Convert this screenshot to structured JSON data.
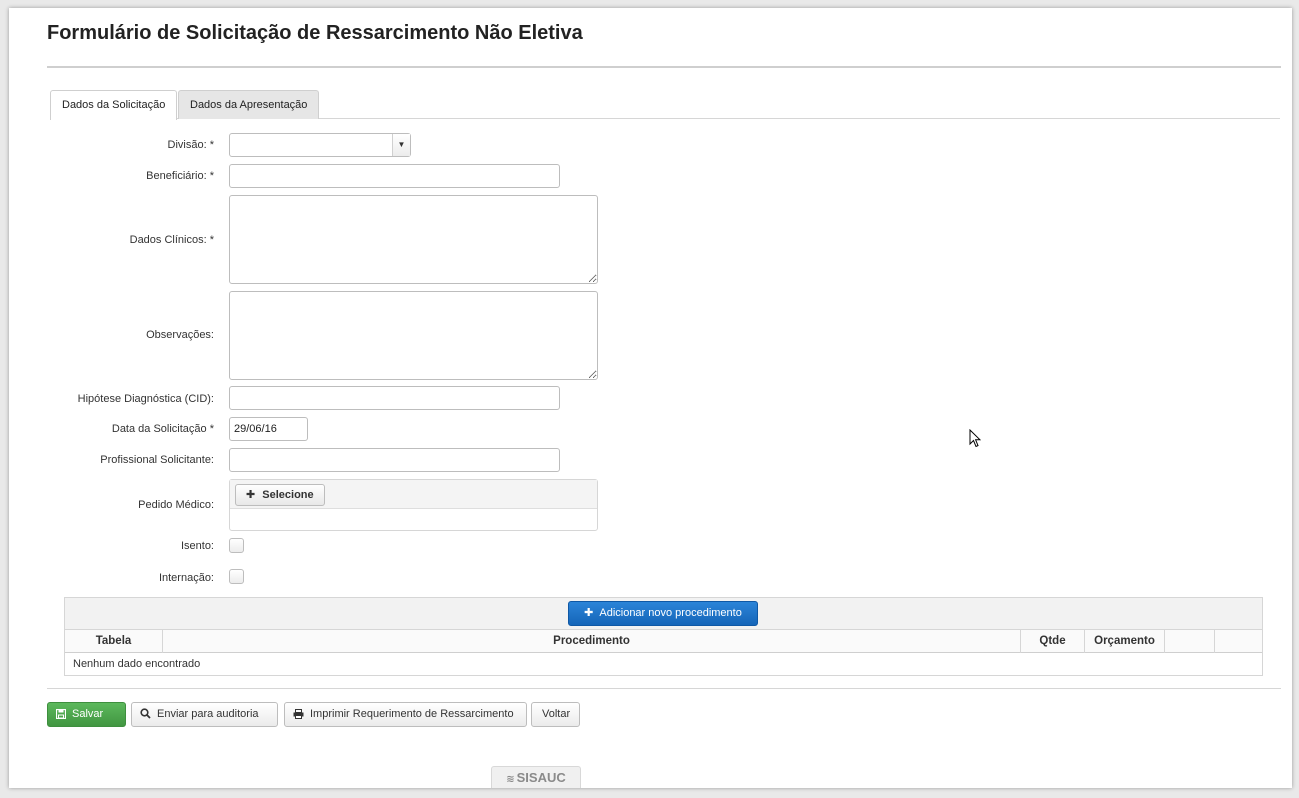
{
  "page": {
    "title": "Formulário de Solicitação de Ressarcimento Não Eletiva"
  },
  "tabs": [
    {
      "label": "Dados da Solicitação",
      "active": true
    },
    {
      "label": "Dados da Apresentação",
      "active": false
    }
  ],
  "form": {
    "divisao": {
      "label": "Divisão: *",
      "value": ""
    },
    "beneficiario": {
      "label": "Beneficiário: *",
      "value": ""
    },
    "dados_clinicos": {
      "label": "Dados Clínicos: *",
      "value": ""
    },
    "observacoes": {
      "label": "Observações:",
      "value": ""
    },
    "hipotese": {
      "label": "Hipótese Diagnóstica (CID):",
      "value": ""
    },
    "data_solicitacao": {
      "label": "Data da Solicitação *",
      "value": "29/06/16"
    },
    "profissional": {
      "label": "Profissional Solicitante:",
      "value": ""
    },
    "pedido_medico": {
      "label": "Pedido Médico:",
      "button": "Selecione"
    },
    "isento": {
      "label": "Isento:",
      "checked": false
    },
    "internacao": {
      "label": "Internação:",
      "checked": false
    }
  },
  "procedures": {
    "add_button": "Adicionar novo procedimento",
    "columns": [
      "Tabela",
      "Procedimento",
      "Qtde",
      "Orçamento",
      ""
    ],
    "empty_message": "Nenhum dado encontrado"
  },
  "actions": {
    "save": "Salvar",
    "audit": "Enviar para auditoria",
    "print": "Imprimir Requerimento de Ressarcimento",
    "back": "Voltar"
  },
  "footer": {
    "brand": "SISAUC"
  },
  "colors": {
    "primary": "#1a6fc4",
    "success": "#4cae4c"
  }
}
